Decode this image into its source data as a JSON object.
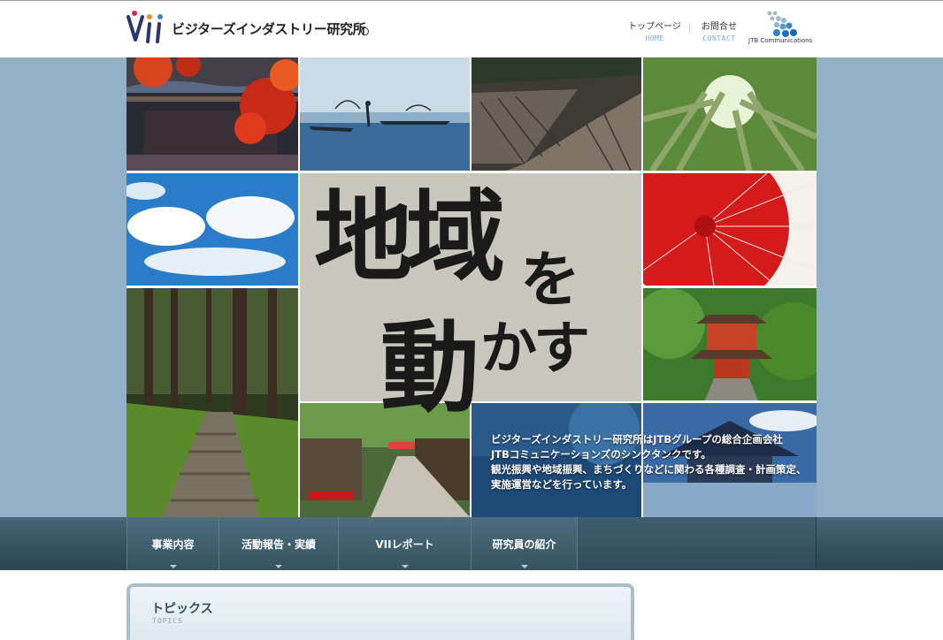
{
  "header": {
    "logo_text": "ビジターズインダストリー研究所",
    "nav": [
      {
        "jp": "トップページ",
        "en": "HOME"
      },
      {
        "jp": "お問合せ",
        "en": "CONTACT"
      }
    ],
    "partner_text": "JTB Communications"
  },
  "hero": {
    "headline": [
      "地域",
      "を",
      "動",
      "かす"
    ],
    "tagline": [
      "ビジターズインダストリー研究所はJTBグループの総合企画会社",
      "JTBコミュニケーションズのシンクタンクです。",
      "観光振興や地域振興、まちづくりなどに関わる各種調査・計画策定、",
      "実施運営などを行っています。"
    ]
  },
  "menu": [
    {
      "label": "事業内容"
    },
    {
      "label": "活動報告・実績"
    },
    {
      "label": "VIIレポート"
    },
    {
      "label": "研究員の紹介"
    }
  ],
  "topics": {
    "title": "トピックス",
    "subtitle": "TOPICS"
  },
  "colors": {
    "hero_side": "#92b0c6",
    "nav_bar": "#34525f",
    "accent_blue": "#7aaad0"
  },
  "icons": [
    "vii-logo-icon",
    "jtb-dots-icon",
    "dropdown-arrow-icon"
  ]
}
